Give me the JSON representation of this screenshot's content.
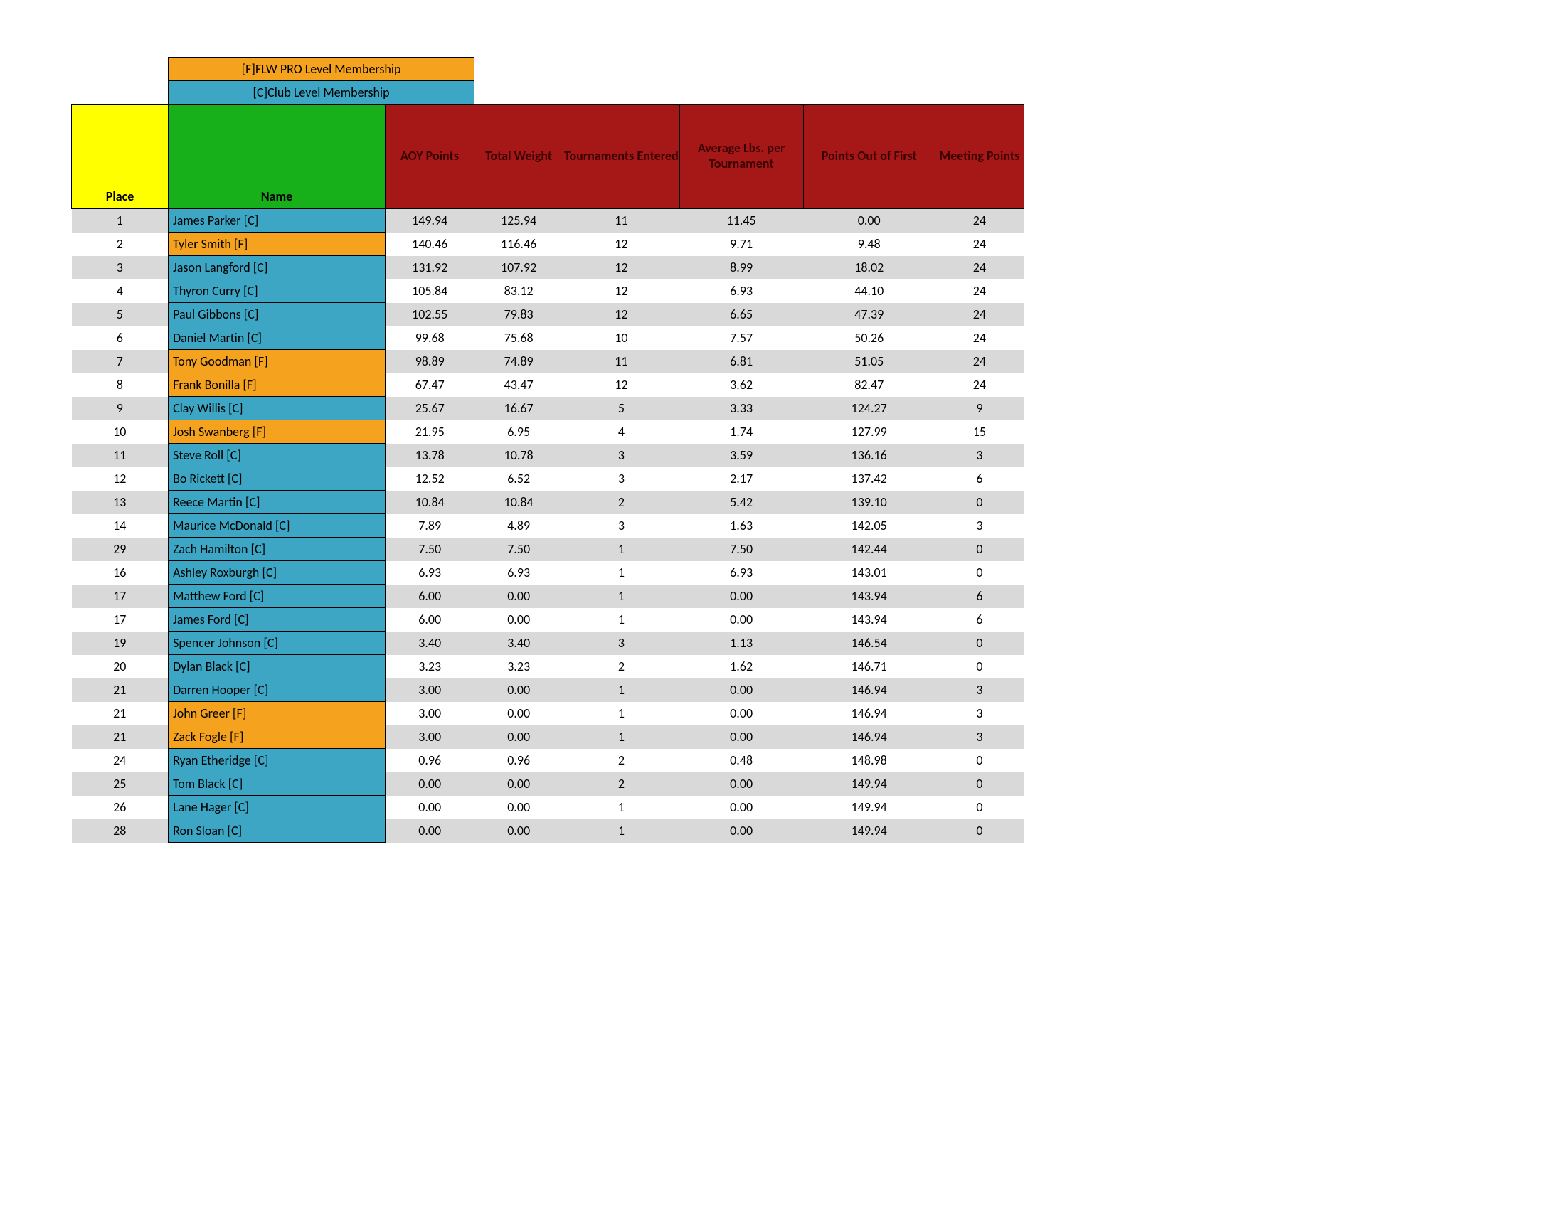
{
  "legend": {
    "flw": "[F]FLW PRO Level Membership",
    "club": "[C]Club Level Membership"
  },
  "headers": {
    "place": "Place",
    "name": "Name",
    "aoy": "AOY Points",
    "total_weight": "Total Weight",
    "tournaments": "Tournaments Entered",
    "avg_lbs": "Average Lbs. per Tournament",
    "points_out": "Points Out of First",
    "meeting": "Meeting Points"
  },
  "rows": [
    {
      "place": "1",
      "name": "James Parker [C]",
      "level": "C",
      "aoy": "149.94",
      "tw": "125.94",
      "te": "11",
      "avg": "11.45",
      "pof": "0.00",
      "mp": "24"
    },
    {
      "place": "2",
      "name": "Tyler Smith [F]",
      "level": "F",
      "aoy": "140.46",
      "tw": "116.46",
      "te": "12",
      "avg": "9.71",
      "pof": "9.48",
      "mp": "24"
    },
    {
      "place": "3",
      "name": "Jason Langford [C]",
      "level": "C",
      "aoy": "131.92",
      "tw": "107.92",
      "te": "12",
      "avg": "8.99",
      "pof": "18.02",
      "mp": "24"
    },
    {
      "place": "4",
      "name": "Thyron Curry [C]",
      "level": "C",
      "aoy": "105.84",
      "tw": "83.12",
      "te": "12",
      "avg": "6.93",
      "pof": "44.10",
      "mp": "24"
    },
    {
      "place": "5",
      "name": "Paul Gibbons [C]",
      "level": "C",
      "aoy": "102.55",
      "tw": "79.83",
      "te": "12",
      "avg": "6.65",
      "pof": "47.39",
      "mp": "24"
    },
    {
      "place": "6",
      "name": "Daniel Martin [C]",
      "level": "C",
      "aoy": "99.68",
      "tw": "75.68",
      "te": "10",
      "avg": "7.57",
      "pof": "50.26",
      "mp": "24"
    },
    {
      "place": "7",
      "name": "Tony Goodman [F]",
      "level": "F",
      "aoy": "98.89",
      "tw": "74.89",
      "te": "11",
      "avg": "6.81",
      "pof": "51.05",
      "mp": "24"
    },
    {
      "place": "8",
      "name": "Frank Bonilla [F]",
      "level": "F",
      "aoy": "67.47",
      "tw": "43.47",
      "te": "12",
      "avg": "3.62",
      "pof": "82.47",
      "mp": "24"
    },
    {
      "place": "9",
      "name": "Clay Willis [C]",
      "level": "C",
      "aoy": "25.67",
      "tw": "16.67",
      "te": "5",
      "avg": "3.33",
      "pof": "124.27",
      "mp": "9"
    },
    {
      "place": "10",
      "name": "Josh Swanberg [F]",
      "level": "F",
      "aoy": "21.95",
      "tw": "6.95",
      "te": "4",
      "avg": "1.74",
      "pof": "127.99",
      "mp": "15"
    },
    {
      "place": "11",
      "name": "Steve Roll [C]",
      "level": "C",
      "aoy": "13.78",
      "tw": "10.78",
      "te": "3",
      "avg": "3.59",
      "pof": "136.16",
      "mp": "3"
    },
    {
      "place": "12",
      "name": "Bo Rickett [C]",
      "level": "C",
      "aoy": "12.52",
      "tw": "6.52",
      "te": "3",
      "avg": "2.17",
      "pof": "137.42",
      "mp": "6"
    },
    {
      "place": "13",
      "name": "Reece Martin [C]",
      "level": "C",
      "aoy": "10.84",
      "tw": "10.84",
      "te": "2",
      "avg": "5.42",
      "pof": "139.10",
      "mp": "0"
    },
    {
      "place": "14",
      "name": "Maurice McDonald [C]",
      "level": "C",
      "aoy": "7.89",
      "tw": "4.89",
      "te": "3",
      "avg": "1.63",
      "pof": "142.05",
      "mp": "3"
    },
    {
      "place": "29",
      "name": "Zach Hamilton [C]",
      "level": "C",
      "aoy": "7.50",
      "tw": "7.50",
      "te": "1",
      "avg": "7.50",
      "pof": "142.44",
      "mp": "0"
    },
    {
      "place": "16",
      "name": "Ashley Roxburgh [C]",
      "level": "C",
      "aoy": "6.93",
      "tw": "6.93",
      "te": "1",
      "avg": "6.93",
      "pof": "143.01",
      "mp": "0"
    },
    {
      "place": "17",
      "name": "Matthew Ford [C]",
      "level": "C",
      "aoy": "6.00",
      "tw": "0.00",
      "te": "1",
      "avg": "0.00",
      "pof": "143.94",
      "mp": "6"
    },
    {
      "place": "17",
      "name": "James Ford [C]",
      "level": "C",
      "aoy": "6.00",
      "tw": "0.00",
      "te": "1",
      "avg": "0.00",
      "pof": "143.94",
      "mp": "6"
    },
    {
      "place": "19",
      "name": "Spencer Johnson [C]",
      "level": "C",
      "aoy": "3.40",
      "tw": "3.40",
      "te": "3",
      "avg": "1.13",
      "pof": "146.54",
      "mp": "0"
    },
    {
      "place": "20",
      "name": "Dylan Black [C]",
      "level": "C",
      "aoy": "3.23",
      "tw": "3.23",
      "te": "2",
      "avg": "1.62",
      "pof": "146.71",
      "mp": "0"
    },
    {
      "place": "21",
      "name": "Darren Hooper [C]",
      "level": "C",
      "aoy": "3.00",
      "tw": "0.00",
      "te": "1",
      "avg": "0.00",
      "pof": "146.94",
      "mp": "3"
    },
    {
      "place": "21",
      "name": "John Greer [F]",
      "level": "F",
      "aoy": "3.00",
      "tw": "0.00",
      "te": "1",
      "avg": "0.00",
      "pof": "146.94",
      "mp": "3"
    },
    {
      "place": "21",
      "name": "Zack Fogle [F]",
      "level": "F",
      "aoy": "3.00",
      "tw": "0.00",
      "te": "1",
      "avg": "0.00",
      "pof": "146.94",
      "mp": "3"
    },
    {
      "place": "24",
      "name": "Ryan Etheridge [C]",
      "level": "C",
      "aoy": "0.96",
      "tw": "0.96",
      "te": "2",
      "avg": "0.48",
      "pof": "148.98",
      "mp": "0"
    },
    {
      "place": "25",
      "name": "Tom Black [C]",
      "level": "C",
      "aoy": "0.00",
      "tw": "0.00",
      "te": "2",
      "avg": "0.00",
      "pof": "149.94",
      "mp": "0"
    },
    {
      "place": "26",
      "name": "Lane Hager [C]",
      "level": "C",
      "aoy": "0.00",
      "tw": "0.00",
      "te": "1",
      "avg": "0.00",
      "pof": "149.94",
      "mp": "0"
    },
    {
      "place": "28",
      "name": "Ron Sloan [C]",
      "level": "C",
      "aoy": "0.00",
      "tw": "0.00",
      "te": "1",
      "avg": "0.00",
      "pof": "149.94",
      "mp": "0"
    }
  ]
}
